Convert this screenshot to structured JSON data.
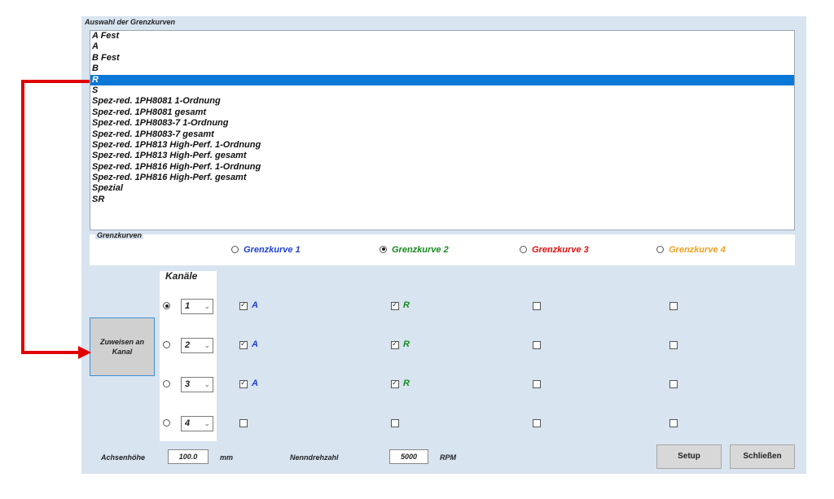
{
  "selection_group": {
    "title": "Auswahl der Grenzkurven",
    "items": [
      "A Fest",
      "A",
      "B Fest",
      "B",
      "R",
      "S",
      "Spez-red. 1PH8081 1-Ordnung",
      "Spez-red. 1PH8081 gesamt",
      "Spez-red. 1PH8083-7 1-Ordnung",
      "Spez-red. 1PH8083-7 gesamt",
      "Spez-red. 1PH813 High-Perf. 1-Ordnung",
      "Spez-red. 1PH813 High-Perf. gesamt",
      "Spez-red. 1PH816 High-Perf. 1-Ordnung",
      "Spez-red. 1PH816 High-Perf. gesamt",
      "Spezial",
      "SR"
    ],
    "selected_index": 4
  },
  "grenzkurven": {
    "title": "Grenzkurven",
    "options": [
      {
        "label": "Grenzkurve 1",
        "color": "#1f3fd6",
        "selected": false
      },
      {
        "label": "Grenzkurve 2",
        "color": "#178a1f",
        "selected": true
      },
      {
        "label": "Grenzkurve 3",
        "color": "#e01010",
        "selected": false
      },
      {
        "label": "Grenzkurve 4",
        "color": "#f0a020",
        "selected": false
      }
    ]
  },
  "kanaele": {
    "title": "Kanäle",
    "assign_button": "Zuweisen an Kanal",
    "rows": [
      {
        "channel": "1",
        "selected": true,
        "gk1": {
          "checked": true,
          "label": "A"
        },
        "gk2": {
          "checked": true,
          "label": "R"
        },
        "gk3": {
          "checked": false,
          "label": ""
        },
        "gk4": {
          "checked": false,
          "label": ""
        }
      },
      {
        "channel": "2",
        "selected": false,
        "gk1": {
          "checked": true,
          "label": "A"
        },
        "gk2": {
          "checked": true,
          "label": "R"
        },
        "gk3": {
          "checked": false,
          "label": ""
        },
        "gk4": {
          "checked": false,
          "label": ""
        }
      },
      {
        "channel": "3",
        "selected": false,
        "gk1": {
          "checked": true,
          "label": "A"
        },
        "gk2": {
          "checked": true,
          "label": "R"
        },
        "gk3": {
          "checked": false,
          "label": ""
        },
        "gk4": {
          "checked": false,
          "label": ""
        }
      },
      {
        "channel": "4",
        "selected": false,
        "gk1": {
          "checked": false,
          "label": ""
        },
        "gk2": {
          "checked": false,
          "label": ""
        },
        "gk3": {
          "checked": false,
          "label": ""
        },
        "gk4": {
          "checked": false,
          "label": ""
        }
      }
    ]
  },
  "footer": {
    "achsenhoehe_label": "Achsenhöhe",
    "achsenhoehe_value": "100.0",
    "achsenhoehe_unit": "mm",
    "nenndrehzahl_label": "Nenndrehzahl",
    "nenndrehzahl_value": "5000",
    "nenndrehzahl_unit": "RPM",
    "setup_label": "Setup",
    "close_label": "Schließen"
  },
  "icons": {
    "chevron": "chevron-down-icon",
    "arrow": "red-arrow-annotation"
  }
}
